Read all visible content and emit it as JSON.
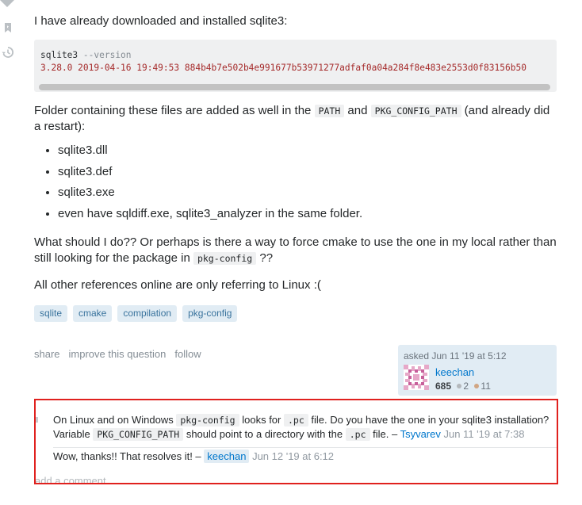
{
  "intro": "I have already downloaded and installed sqlite3:",
  "code": {
    "command": "sqlite3",
    "flag": "--version",
    "output": "3.28.0 2019-04-16 19:49:53 884b4b7e502b4e991677b53971277adfaf0a04a284f8e483e2553d0f83156b50"
  },
  "folder_text": {
    "before": "Folder containing these files are added as well in the ",
    "path": "PATH",
    "and": " and ",
    "pkg_config_path": "PKG_CONFIG_PATH",
    "after": " (and already did a restart):"
  },
  "files": [
    "sqlite3.dll",
    "sqlite3.def",
    "sqlite3.exe",
    "even have sqldiff.exe, sqlite3_analyzer in the same folder."
  ],
  "question": {
    "before": "What should I do?? Or perhaps is there a way to force cmake to use the one in my local rather than still looking for the package in ",
    "code": "pkg-config",
    "after": " ??"
  },
  "references": "All other references online are only referring to Linux :(",
  "tags": [
    "sqlite",
    "cmake",
    "compilation",
    "pkg-config"
  ],
  "menu": {
    "share": "share",
    "improve": "improve this question",
    "follow": "follow"
  },
  "owner": {
    "asked": "asked Jun 11 '19 at 5:12",
    "name": "keechan",
    "reputation": "685",
    "silver": "2",
    "bronze": "11",
    "silver_color": "#b4b8bc",
    "bronze_color": "#d1a684"
  },
  "comments": [
    {
      "t1": "On Linux and on Windows ",
      "c1": "pkg-config",
      "t2": " looks for ",
      "c2": ".pc",
      "t3": " file. Do you have the one in your sqlite3 installation?",
      "t4": "Variable ",
      "c3": "PKG_CONFIG_PATH",
      "t5": " should point to a directory with the ",
      "c4": ".pc",
      "t6": " file. – ",
      "user": "Tsyvarev",
      "date": "Jun 11 '19 at 7:38"
    },
    {
      "text": "Wow, thanks!! That resolves it! – ",
      "user": "keechan",
      "date": "Jun 12 '19 at 6:12"
    }
  ],
  "add_comment": "add a comment",
  "highlight_color": "#e0211e"
}
